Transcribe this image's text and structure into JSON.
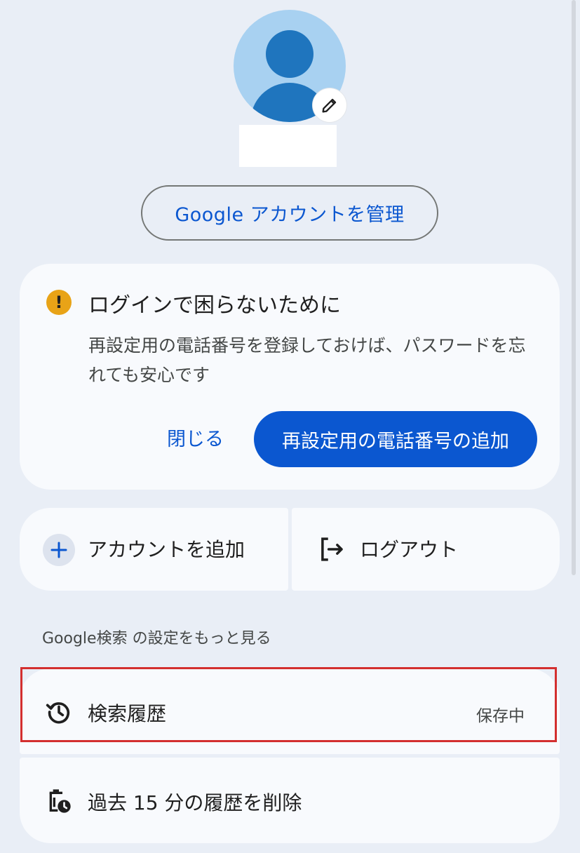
{
  "profile": {
    "manage_account_label": "Google アカウントを管理"
  },
  "security_notice": {
    "title": "ログインで困らないために",
    "body": "再設定用の電話番号を登録しておけば、パスワードを忘れても安心です",
    "close_label": "閉じる",
    "add_phone_label": "再設定用の電話番号の追加",
    "icon": "warning-icon"
  },
  "account_actions": {
    "add_account_label": "アカウントを追加",
    "logout_label": "ログアウト"
  },
  "search_settings": {
    "section_label": "Google検索 の設定をもっと見る",
    "history_label": "検索履歴",
    "history_status": "保存中",
    "delete_recent_label": "過去 15 分の履歴を削除"
  },
  "colors": {
    "accent": "#0b57d0",
    "warning": "#e8a317",
    "highlight": "#d32f2f",
    "background": "#e9eef6",
    "card": "#f8fafd"
  }
}
